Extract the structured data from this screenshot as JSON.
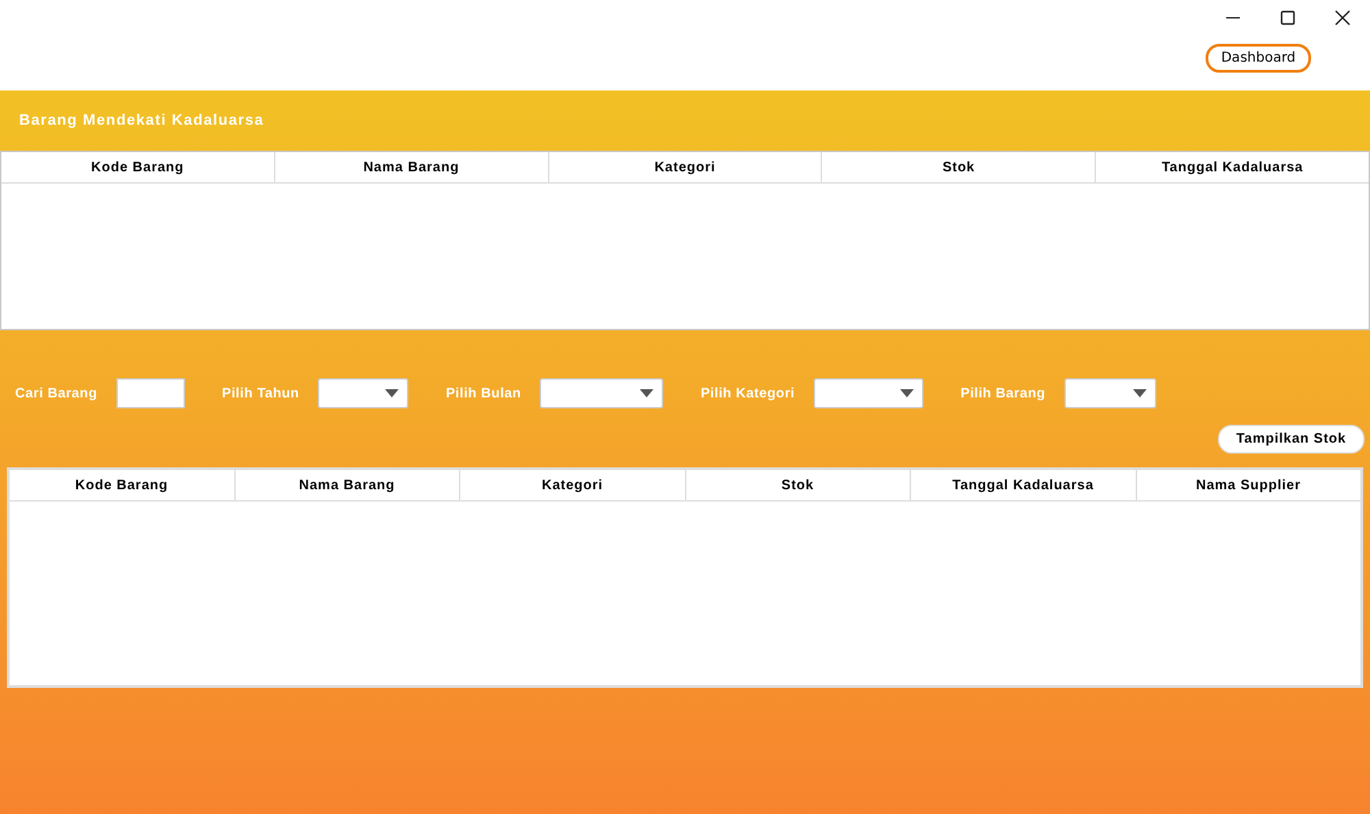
{
  "header": {
    "button": "Dashboard"
  },
  "expiring_section": {
    "title": "Barang Mendekati Kadaluarsa",
    "table": {
      "columns": [
        "Kode Barang",
        "Nama Barang",
        "Kategori",
        "Stok",
        "Tanggal Kadaluarsa"
      ]
    }
  },
  "filters": [
    {
      "label": "Cari Barang",
      "kind": "text"
    },
    {
      "label": "Pilih Tahun",
      "kind": "dropdown"
    },
    {
      "label": "Pilih Bulan",
      "kind": "dropdown"
    },
    {
      "label": "Pilih Kategori",
      "kind": "dropdown"
    },
    {
      "label": "Pilih Barang",
      "kind": "dropdown"
    }
  ],
  "show_button": "Tampilkan Stok",
  "stock_table": {
    "columns": [
      "Kode Barang",
      "Nama Barang",
      "Kategori",
      "Stok",
      "Tanggal Kadaluarsa",
      "Nama Supplier"
    ]
  }
}
